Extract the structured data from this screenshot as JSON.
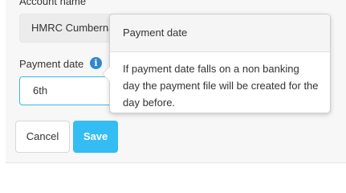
{
  "form": {
    "account_name_label": "Account name",
    "account_name_value": "HMRC Cumbernauld",
    "payment_date_label": "Payment date",
    "payment_date_value": "6th",
    "info_icon_glyph": "i"
  },
  "actions": {
    "cancel_label": "Cancel",
    "save_label": "Save"
  },
  "tooltip": {
    "title": "Payment date",
    "body": "If payment date falls on a non banking day the payment file will be created for the day before."
  },
  "colors": {
    "accent": "#34bdf2",
    "info_icon": "#2f88cf",
    "focus_border": "#36b7e8"
  }
}
